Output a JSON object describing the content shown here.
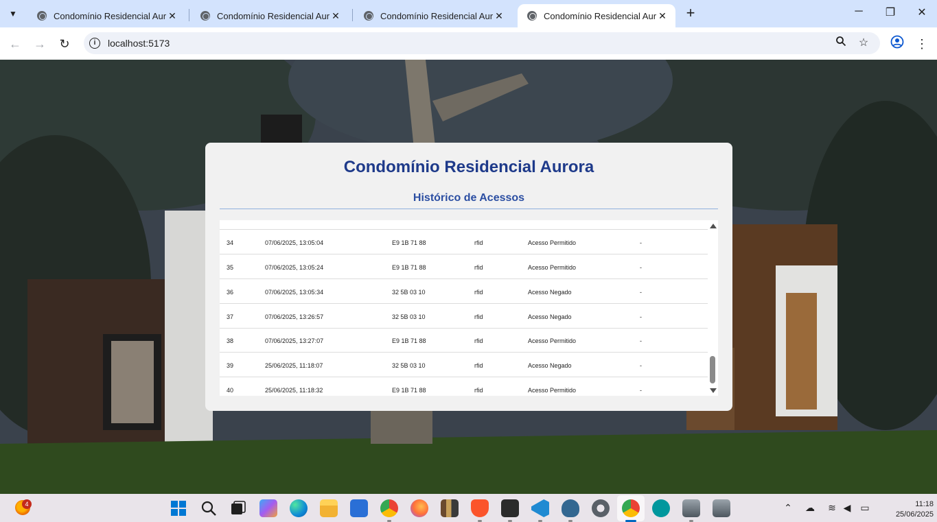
{
  "browser": {
    "tabs": [
      {
        "title": "Condomínio Residencial Aurora",
        "active": false
      },
      {
        "title": "Condomínio Residencial Aurora",
        "active": false
      },
      {
        "title": "Condomínio Residencial Aurora",
        "active": false
      },
      {
        "title": "Condomínio Residencial Aurora",
        "active": true
      }
    ],
    "close_glyph": "✕",
    "new_tab_glyph": "+",
    "url": "localhost:5173"
  },
  "page": {
    "title": "Condomínio Residencial Aurora",
    "subtitle": "Histórico de Acessos",
    "rows": [
      {
        "id": "34",
        "datetime": "07/06/2025, 13:05:04",
        "card": "E9 1B 71 88",
        "type": "rfid",
        "status": "Acesso Permitido",
        "obs": "-"
      },
      {
        "id": "35",
        "datetime": "07/06/2025, 13:05:24",
        "card": "E9 1B 71 88",
        "type": "rfid",
        "status": "Acesso Permitido",
        "obs": "-"
      },
      {
        "id": "36",
        "datetime": "07/06/2025, 13:05:34",
        "card": "32 5B 03 10",
        "type": "rfid",
        "status": "Acesso Negado",
        "obs": "-"
      },
      {
        "id": "37",
        "datetime": "07/06/2025, 13:26:57",
        "card": "32 5B 03 10",
        "type": "rfid",
        "status": "Acesso Negado",
        "obs": "-"
      },
      {
        "id": "38",
        "datetime": "07/06/2025, 13:27:07",
        "card": "E9 1B 71 88",
        "type": "rfid",
        "status": "Acesso Permitido",
        "obs": "-"
      },
      {
        "id": "39",
        "datetime": "25/06/2025, 11:18:07",
        "card": "32 5B 03 10",
        "type": "rfid",
        "status": "Acesso Negado",
        "obs": "-"
      },
      {
        "id": "40",
        "datetime": "25/06/2025, 11:18:32",
        "card": "E9 1B 71 88",
        "type": "rfid",
        "status": "Acesso Permitido",
        "obs": "-"
      }
    ]
  },
  "taskbar": {
    "weather_badge": "4",
    "apps": [
      "start",
      "search",
      "task-view",
      "copilot",
      "edge",
      "file-explorer",
      "store",
      "chrome",
      "firefox",
      "library",
      "brave",
      "terminal",
      "vscode",
      "postgres",
      "settings",
      "chrome-active",
      "arduino",
      "server-1",
      "server-2"
    ],
    "time": "11:18",
    "date": "25/06/2025"
  },
  "colors": {
    "title_blue": "#1e3a8a",
    "subtitle_blue": "#2b4ea2",
    "tabbar": "#d3e3fd"
  }
}
